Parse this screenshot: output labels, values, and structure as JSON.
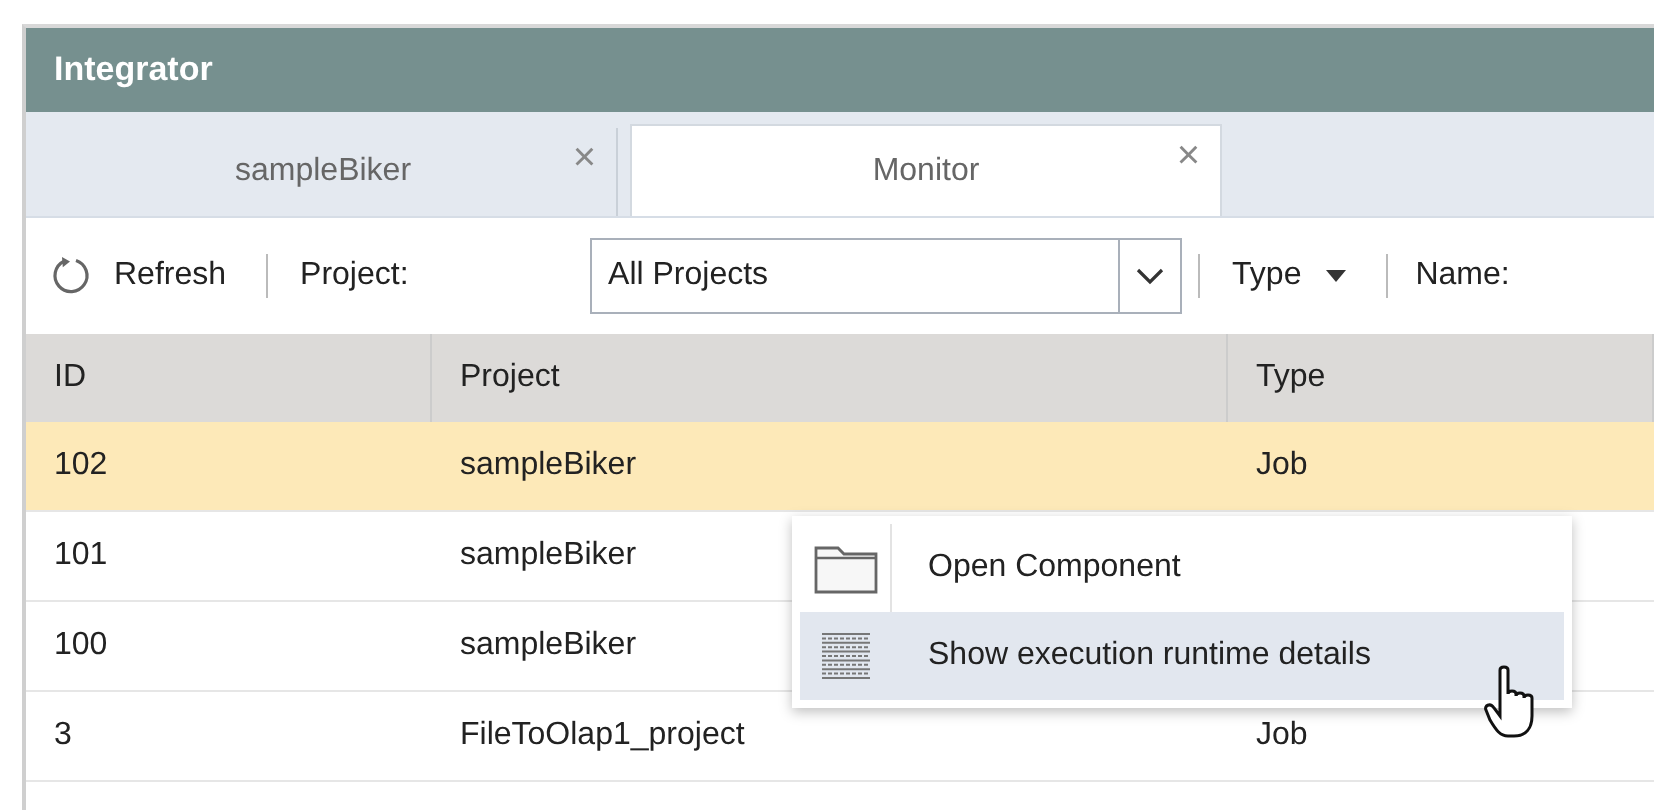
{
  "window": {
    "title": "Integrator"
  },
  "tabs": [
    {
      "label": "sampleBiker",
      "close": "×",
      "selected": false
    },
    {
      "label": "Monitor",
      "close": "×",
      "selected": true
    }
  ],
  "toolbar": {
    "refresh": "Refresh",
    "project_label": "Project:",
    "project_value": "All Projects",
    "type_label": "Type",
    "name_label": "Name:"
  },
  "table": {
    "columns": [
      "ID",
      "Project",
      "Type"
    ],
    "rows": [
      {
        "cells": [
          "102",
          "sampleBiker",
          "Job"
        ],
        "selected": true
      },
      {
        "cells": [
          "101",
          "sampleBiker",
          ""
        ],
        "selected": false
      },
      {
        "cells": [
          "100",
          "sampleBiker",
          ""
        ],
        "selected": false
      },
      {
        "cells": [
          "3",
          "FileToOlap1_project",
          "Job"
        ],
        "selected": false
      }
    ]
  },
  "context_menu": {
    "items": [
      {
        "kind": "folder",
        "label": "Open Component",
        "selected": false
      },
      {
        "kind": "list",
        "label": "Show execution runtime details",
        "selected": true
      }
    ]
  }
}
